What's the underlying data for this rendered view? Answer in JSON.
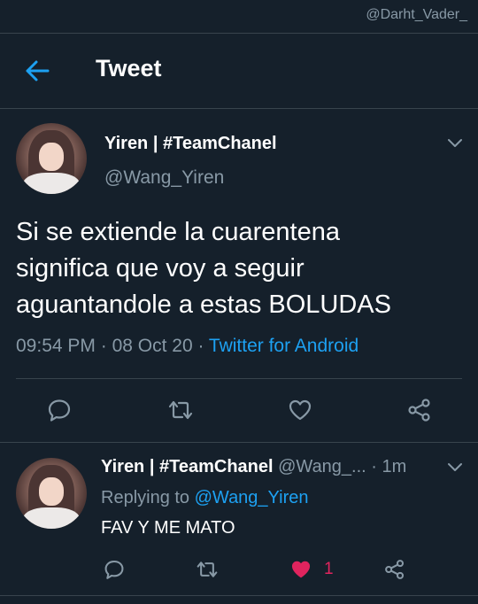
{
  "watermark": "@Darht_Vader_",
  "header": {
    "title": "Tweet",
    "back_icon": "arrow-left-icon"
  },
  "main_tweet": {
    "display_name": "Yiren | #TeamChanel",
    "handle": "@Wang_Yiren",
    "lines": [
      "Si se extiende la cuarentena",
      "significa que voy a seguir",
      "aguantandole a estas BOLUDAS"
    ],
    "time": "09:54 PM",
    "date": "08 Oct 20",
    "separator": " · ",
    "source": "Twitter for Android",
    "actions": [
      "reply-icon",
      "retweet-icon",
      "like-icon",
      "share-icon"
    ]
  },
  "reply_tweet": {
    "display_name": "Yiren | #TeamChanel",
    "handle": "@Wang_...",
    "time_sep": " · ",
    "time": "1m",
    "replying_label": "Replying to ",
    "replying_to": "@Wang_Yiren",
    "text": "FAV Y ME MATO",
    "like_count": "1",
    "actions": [
      "reply-icon",
      "retweet-icon",
      "liked-heart-icon",
      "share-icon"
    ]
  },
  "colors": {
    "background": "#15202b",
    "accent": "#1da1f2",
    "muted": "#8899a6",
    "divider": "#38444d",
    "like": "#e0245e"
  }
}
